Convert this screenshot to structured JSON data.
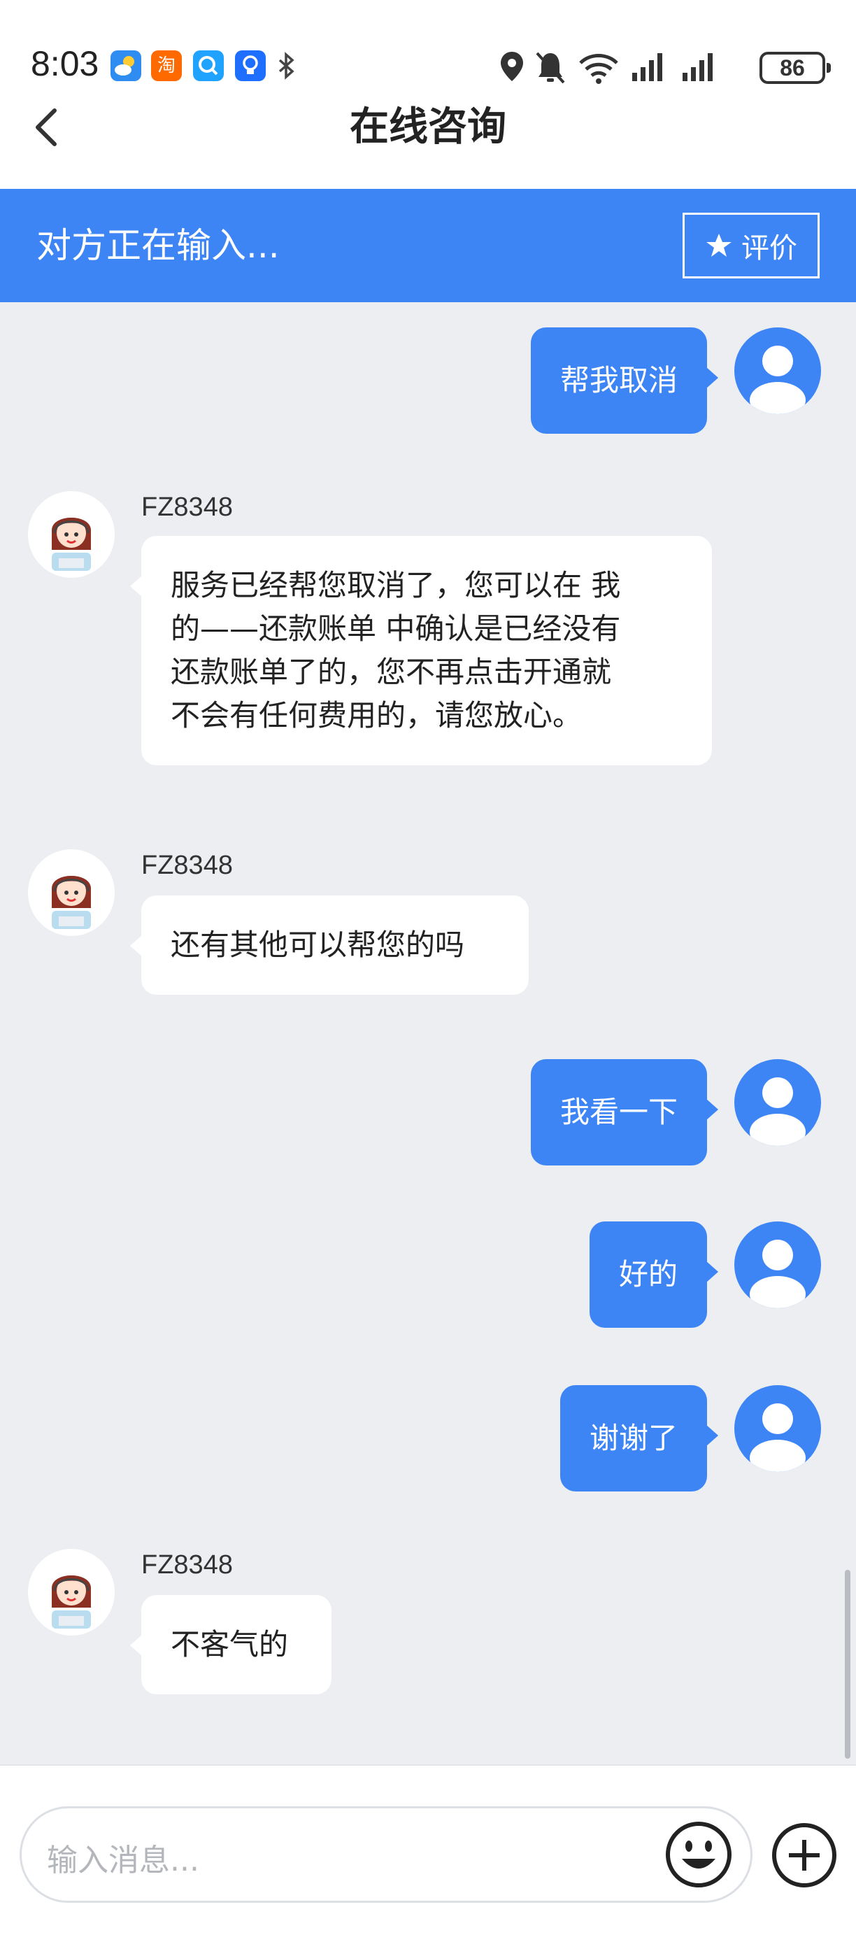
{
  "status_bar": {
    "time": "8:03",
    "battery": "86",
    "app_icons": [
      "weather-icon",
      "taobao-icon",
      "search-app-icon",
      "bulb-app-icon",
      "bluetooth-icon"
    ],
    "taobao_glyph": "淘"
  },
  "header": {
    "title": "在线咨询"
  },
  "banner": {
    "typing_text": "对方正在输入...",
    "rate_label": "评价"
  },
  "messages": [
    {
      "from": "user",
      "text": "帮我取消"
    },
    {
      "from": "agent",
      "sender": "FZ8348",
      "lines": [
        "服务已经帮您取消了，您可以在 我",
        "的——还款账单 中确认是已经没有",
        "还款账单了的，您不再点击开通就",
        "不会有任何费用的，请您放心。"
      ]
    },
    {
      "from": "agent",
      "sender": "FZ8348",
      "text": "还有其他可以帮您的吗"
    },
    {
      "from": "user",
      "text": "我看一下"
    },
    {
      "from": "user",
      "text": "好的"
    },
    {
      "from": "user",
      "text": "谢谢了"
    },
    {
      "from": "agent",
      "sender": "FZ8348",
      "text": "不客气的"
    }
  ],
  "composer": {
    "placeholder": "输入消息..."
  },
  "colors": {
    "accent": "#3d85f5",
    "background": "#eceef1"
  }
}
